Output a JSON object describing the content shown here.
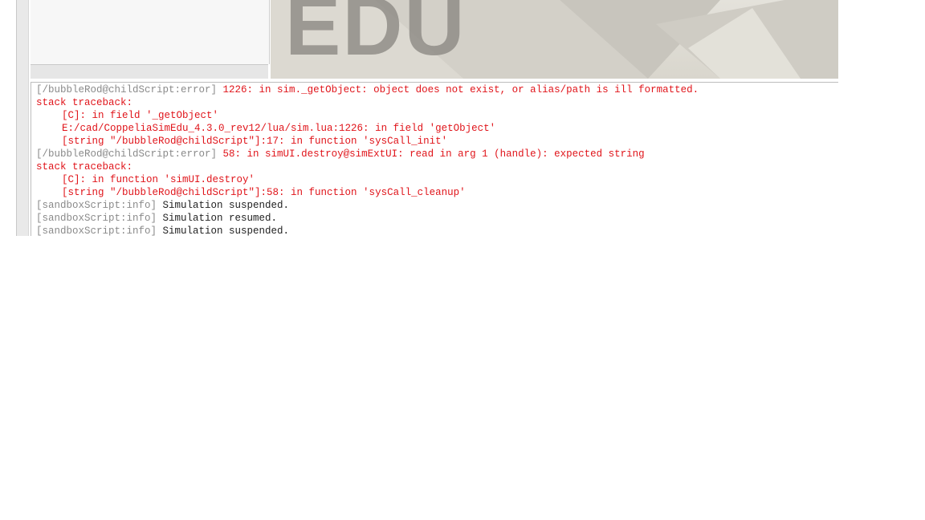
{
  "viewport": {
    "watermark": "EDU"
  },
  "console": {
    "lines": [
      {
        "tag": "[/bubbleRod@childScript:error]",
        "text": " 1226: in sim._getObject: object does not exist, or alias/path is ill formatted.",
        "kind": "error"
      },
      {
        "tag": "",
        "text": "stack traceback:",
        "kind": "error"
      },
      {
        "tag": "",
        "text": "[C]: in field '_getObject'",
        "kind": "error-indent"
      },
      {
        "tag": "",
        "text": "E:/cad/CoppeliaSimEdu_4.3.0_rev12/lua/sim.lua:1226: in field 'getObject'",
        "kind": "error-indent"
      },
      {
        "tag": "",
        "text": "[string \"/bubbleRod@childScript\"]:17: in function 'sysCall_init'",
        "kind": "error-indent"
      },
      {
        "tag": "[/bubbleRod@childScript:error]",
        "text": " 58: in simUI.destroy@simExtUI: read in arg 1 (handle): expected string",
        "kind": "error"
      },
      {
        "tag": "",
        "text": "stack traceback:",
        "kind": "error"
      },
      {
        "tag": "",
        "text": "[C]: in function 'simUI.destroy'",
        "kind": "error-indent"
      },
      {
        "tag": "",
        "text": "[string \"/bubbleRod@childScript\"]:58: in function 'sysCall_cleanup'",
        "kind": "error-indent"
      },
      {
        "tag": "[sandboxScript:info]",
        "text": " Simulation suspended.",
        "kind": "info"
      },
      {
        "tag": "[sandboxScript:info]",
        "text": " Simulation resumed.",
        "kind": "info"
      },
      {
        "tag": "[sandboxScript:info]",
        "text": " Simulation suspended.",
        "kind": "info"
      }
    ]
  },
  "colors": {
    "error": "#e0141a",
    "tag": "#8a8a8a",
    "info": "#222222"
  }
}
